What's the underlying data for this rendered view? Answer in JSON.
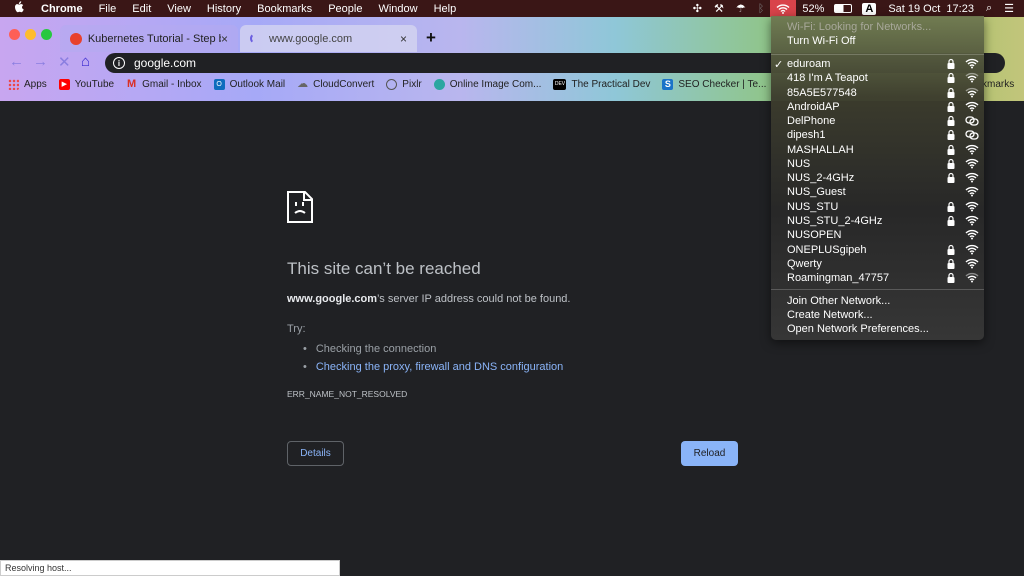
{
  "menubar": {
    "apple": "",
    "app": "Chrome",
    "items": [
      "File",
      "Edit",
      "View",
      "History",
      "Bookmarks",
      "People",
      "Window",
      "Help"
    ],
    "battery": "52%",
    "input_source": "A",
    "datetime": "Sat 19 Oct  17:23"
  },
  "tabs": [
    {
      "title": "Kubernetes Tutorial - Step by S",
      "close": "×"
    },
    {
      "title": "www.google.com",
      "close": "×",
      "loading": true
    }
  ],
  "new_tab": "+",
  "omnibox": {
    "value": "google.com",
    "info": "i"
  },
  "bookmarks": [
    {
      "label": "Apps",
      "icon": "apps-grid-icon"
    },
    {
      "label": "YouTube",
      "icon": "youtube-icon",
      "color": "#ff0000"
    },
    {
      "label": "Gmail - Inbox",
      "icon": "gmail-icon",
      "color": "#d93025"
    },
    {
      "label": "Outlook Mail",
      "icon": "outlook-icon",
      "color": "#0f6cbd"
    },
    {
      "label": "CloudConvert",
      "icon": "cloud-icon",
      "color": "#888888"
    },
    {
      "label": "Pixlr",
      "icon": "pixlr-icon",
      "color": "#555555"
    },
    {
      "label": "Online Image Com...",
      "icon": "image-icon",
      "color": "#2aa6a0"
    },
    {
      "label": "The Practical Dev",
      "icon": "dev-icon",
      "color": "#000000",
      "text": "DEV"
    },
    {
      "label": "SEO Checker | Te...",
      "icon": "seo-icon",
      "color": "#1a73c8",
      "text": "S"
    }
  ],
  "bookmarks_right": "kmarks",
  "error": {
    "title": "This site can’t be reached",
    "host": "www.google.com",
    "desc": "’s server IP address could not be found.",
    "try": "Try:",
    "suggestions": [
      "Checking the connection",
      "Checking the proxy, firewall and DNS configuration"
    ],
    "code": "ERR_NAME_NOT_RESOLVED",
    "details": "Details",
    "reload": "Reload"
  },
  "status": "Resolving host...",
  "wifi_menu": {
    "status": "Wi-Fi: Looking for Networks...",
    "toggle": "Turn Wi-Fi Off",
    "networks": [
      {
        "name": "eduroam",
        "connected": true,
        "locked": true,
        "signal": "full"
      },
      {
        "name": "418 I'm A Teapot",
        "locked": true,
        "signal": "weak"
      },
      {
        "name": "85A5E577548",
        "locked": true,
        "signal": "weak"
      },
      {
        "name": "AndroidAP",
        "locked": true,
        "signal": "full"
      },
      {
        "name": "DelPhone",
        "locked": true,
        "signal": "hotspot"
      },
      {
        "name": "dipesh1",
        "locked": true,
        "signal": "hotspot"
      },
      {
        "name": "MASHALLAH",
        "locked": true,
        "signal": "full"
      },
      {
        "name": "NUS",
        "locked": true,
        "signal": "full"
      },
      {
        "name": "NUS_2-4GHz",
        "locked": true,
        "signal": "full"
      },
      {
        "name": "NUS_Guest",
        "locked": false,
        "signal": "full"
      },
      {
        "name": "NUS_STU",
        "locked": true,
        "signal": "full"
      },
      {
        "name": "NUS_STU_2-4GHz",
        "locked": true,
        "signal": "full"
      },
      {
        "name": "NUSOPEN",
        "locked": false,
        "signal": "full"
      },
      {
        "name": "ONEPLUSgipeh",
        "locked": true,
        "signal": "full"
      },
      {
        "name": "Qwerty",
        "locked": true,
        "signal": "full"
      },
      {
        "name": "Roamingman_47757",
        "locked": true,
        "signal": "weak"
      }
    ],
    "actions": [
      "Join Other Network...",
      "Create Network...",
      "Open Network Preferences..."
    ]
  },
  "colors": {
    "page_bg": "#202124",
    "link": "#8ab4f8",
    "wifi_active": "#d9434a"
  }
}
